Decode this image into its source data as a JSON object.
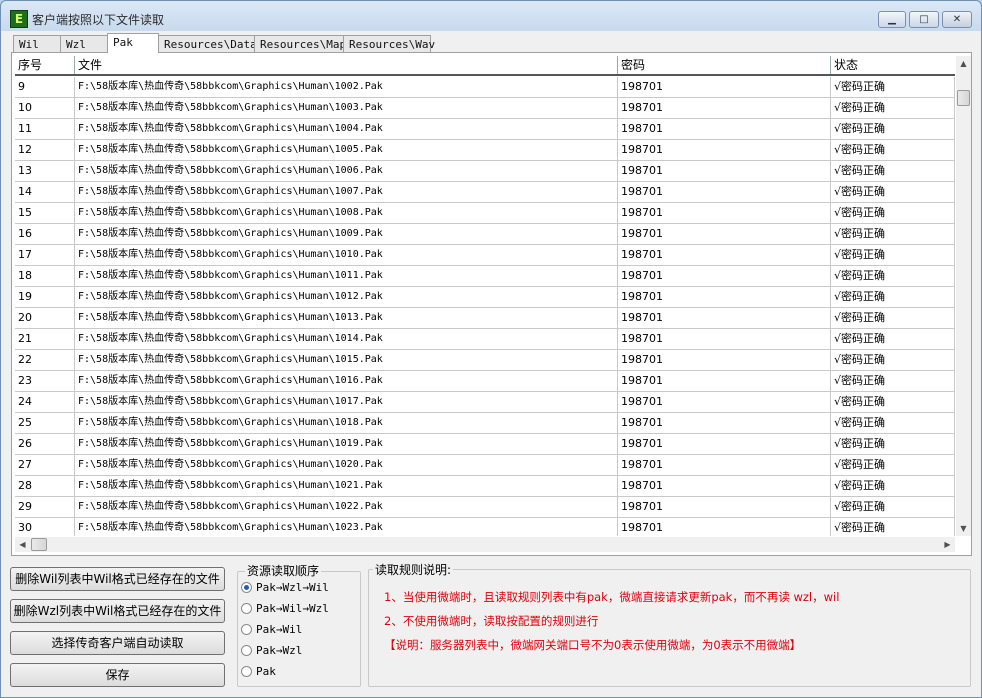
{
  "window": {
    "title": "客户端按照以下文件读取",
    "icon_letter": "E",
    "minimize_glyph": "▁",
    "maximize_glyph": "□",
    "close_glyph": "✕"
  },
  "tabs": [
    {
      "label": "Wil",
      "active": false
    },
    {
      "label": "Wzl",
      "active": false
    },
    {
      "label": "Pak",
      "active": true
    },
    {
      "label": "Resources\\Data",
      "active": false
    },
    {
      "label": "Resources\\Map",
      "active": false
    },
    {
      "label": "Resources\\Wav",
      "active": false
    }
  ],
  "table": {
    "columns": [
      "序号",
      "文件",
      "密码",
      "状态"
    ],
    "rows": [
      {
        "index": "9",
        "file": "F:\\58版本库\\热血传奇\\58bbkcom\\Graphics\\Human\\1002.Pak",
        "password": "198701",
        "status": "√密码正确"
      },
      {
        "index": "10",
        "file": "F:\\58版本库\\热血传奇\\58bbkcom\\Graphics\\Human\\1003.Pak",
        "password": "198701",
        "status": "√密码正确"
      },
      {
        "index": "11",
        "file": "F:\\58版本库\\热血传奇\\58bbkcom\\Graphics\\Human\\1004.Pak",
        "password": "198701",
        "status": "√密码正确"
      },
      {
        "index": "12",
        "file": "F:\\58版本库\\热血传奇\\58bbkcom\\Graphics\\Human\\1005.Pak",
        "password": "198701",
        "status": "√密码正确"
      },
      {
        "index": "13",
        "file": "F:\\58版本库\\热血传奇\\58bbkcom\\Graphics\\Human\\1006.Pak",
        "password": "198701",
        "status": "√密码正确"
      },
      {
        "index": "14",
        "file": "F:\\58版本库\\热血传奇\\58bbkcom\\Graphics\\Human\\1007.Pak",
        "password": "198701",
        "status": "√密码正确"
      },
      {
        "index": "15",
        "file": "F:\\58版本库\\热血传奇\\58bbkcom\\Graphics\\Human\\1008.Pak",
        "password": "198701",
        "status": "√密码正确"
      },
      {
        "index": "16",
        "file": "F:\\58版本库\\热血传奇\\58bbkcom\\Graphics\\Human\\1009.Pak",
        "password": "198701",
        "status": "√密码正确"
      },
      {
        "index": "17",
        "file": "F:\\58版本库\\热血传奇\\58bbkcom\\Graphics\\Human\\1010.Pak",
        "password": "198701",
        "status": "√密码正确"
      },
      {
        "index": "18",
        "file": "F:\\58版本库\\热血传奇\\58bbkcom\\Graphics\\Human\\1011.Pak",
        "password": "198701",
        "status": "√密码正确"
      },
      {
        "index": "19",
        "file": "F:\\58版本库\\热血传奇\\58bbkcom\\Graphics\\Human\\1012.Pak",
        "password": "198701",
        "status": "√密码正确"
      },
      {
        "index": "20",
        "file": "F:\\58版本库\\热血传奇\\58bbkcom\\Graphics\\Human\\1013.Pak",
        "password": "198701",
        "status": "√密码正确"
      },
      {
        "index": "21",
        "file": "F:\\58版本库\\热血传奇\\58bbkcom\\Graphics\\Human\\1014.Pak",
        "password": "198701",
        "status": "√密码正确"
      },
      {
        "index": "22",
        "file": "F:\\58版本库\\热血传奇\\58bbkcom\\Graphics\\Human\\1015.Pak",
        "password": "198701",
        "status": "√密码正确"
      },
      {
        "index": "23",
        "file": "F:\\58版本库\\热血传奇\\58bbkcom\\Graphics\\Human\\1016.Pak",
        "password": "198701",
        "status": "√密码正确"
      },
      {
        "index": "24",
        "file": "F:\\58版本库\\热血传奇\\58bbkcom\\Graphics\\Human\\1017.Pak",
        "password": "198701",
        "status": "√密码正确"
      },
      {
        "index": "25",
        "file": "F:\\58版本库\\热血传奇\\58bbkcom\\Graphics\\Human\\1018.Pak",
        "password": "198701",
        "status": "√密码正确"
      },
      {
        "index": "26",
        "file": "F:\\58版本库\\热血传奇\\58bbkcom\\Graphics\\Human\\1019.Pak",
        "password": "198701",
        "status": "√密码正确"
      },
      {
        "index": "27",
        "file": "F:\\58版本库\\热血传奇\\58bbkcom\\Graphics\\Human\\1020.Pak",
        "password": "198701",
        "status": "√密码正确"
      },
      {
        "index": "28",
        "file": "F:\\58版本库\\热血传奇\\58bbkcom\\Graphics\\Human\\1021.Pak",
        "password": "198701",
        "status": "√密码正确"
      },
      {
        "index": "29",
        "file": "F:\\58版本库\\热血传奇\\58bbkcom\\Graphics\\Human\\1022.Pak",
        "password": "198701",
        "status": "√密码正确"
      },
      {
        "index": "30",
        "file": "F:\\58版本库\\热血传奇\\58bbkcom\\Graphics\\Human\\1023.Pak",
        "password": "198701",
        "status": "√密码正确"
      }
    ]
  },
  "scrollbars": {
    "up_glyph": "▲",
    "down_glyph": "▼",
    "left_glyph": "◀",
    "right_glyph": "▶"
  },
  "buttons": {
    "delete_wil": "删除Wil列表中Wil格式已经存在的文件",
    "delete_wzl": "删除Wzl列表中Wil格式已经存在的文件",
    "auto_read": "选择传奇客户端自动读取",
    "save": "保存"
  },
  "order_group": {
    "title": "资源读取顺序",
    "options": [
      {
        "label": "Pak→Wzl→Wil",
        "selected": true
      },
      {
        "label": "Pak→Wil→Wzl",
        "selected": false
      },
      {
        "label": "Pak→Wil",
        "selected": false
      },
      {
        "label": "Pak→Wzl",
        "selected": false
      },
      {
        "label": "Pak",
        "selected": false
      }
    ]
  },
  "rules_group": {
    "title": "读取规则说明:",
    "lines": [
      "1、当使用微端时，且读取规则列表中有pak，微端直接请求更新pak，而不再读 wzl，wil",
      "2、不使用微端时，读取按配置的规则进行",
      "【说明：服务器列表中，微端网关端口号不为0表示使用微端，为0表示不用微端】"
    ],
    "text_color": "#e0000d"
  }
}
